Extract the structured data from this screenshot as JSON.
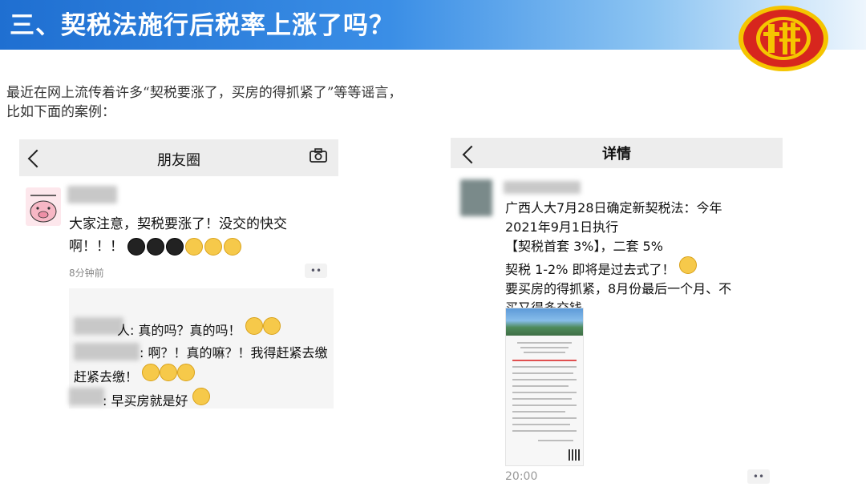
{
  "header": {
    "title": "三、契税法施行后税率上涨了吗？",
    "emblem_icon": "tax-emblem-icon"
  },
  "intro": {
    "line1": "最近在网上流传着许多“契税要涨了，买房的得抓紧了”等等谣言，",
    "line2": "比如下面的案例："
  },
  "moments": {
    "title": "朋友圈",
    "post_line1": "大家注意，契税要涨了！没交的快交",
    "post_line2": "啊！！！",
    "time_ago": "8分钟前",
    "more": "••",
    "comments": [
      {
        "text": "人: 真的吗？真的吗！"
      },
      {
        "text": ": 啊？！真的嘛？！我得赶紧去缴"
      },
      {
        "text": "赶紧去缴！"
      },
      {
        "text": ": 早买房就是好"
      }
    ]
  },
  "detail": {
    "title": "详情",
    "lines": [
      "广西人大7月28日确定新契税法：今年",
      "2021年9月1日执行",
      "【契税首套 3%】，二套 5%",
      "契税 1-2% 即将是过去式了！",
      "要买房的得抓紧，8月份最后一个月、不",
      "买又得多交钱"
    ],
    "time": "20:00",
    "more": "••"
  },
  "colors": {
    "banner_start": "#1f6fd1",
    "emblem_red": "#d7261e",
    "emblem_gold": "#f5c500"
  }
}
